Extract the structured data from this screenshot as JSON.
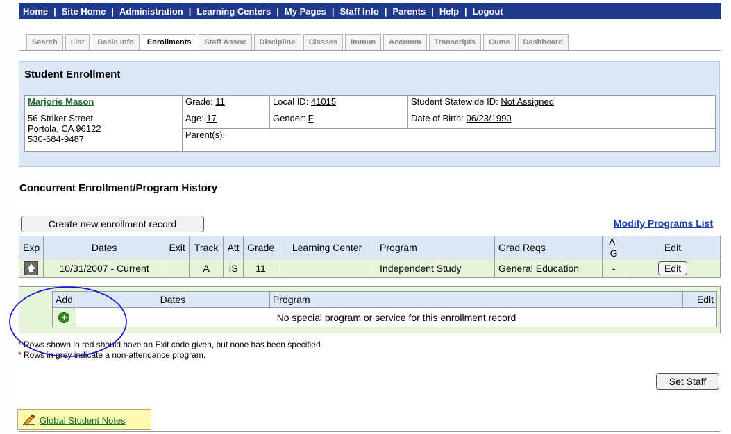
{
  "topnav": {
    "items": [
      "Home",
      "Site Home",
      "Administration",
      "Learning Centers",
      "My Pages",
      "Staff Info",
      "Parents",
      "Help",
      "Logout"
    ],
    "separator": "|"
  },
  "tabs": [
    "Search",
    "List",
    "Basic Info",
    "Enrollments",
    "Staff Assoc",
    "Discipline",
    "Classes",
    "Immun",
    "Accomm",
    "Transcripts",
    "Cume",
    "Dashboard"
  ],
  "active_tab": "Enrollments",
  "student": {
    "section_title": "Student Enrollment",
    "name": "Marjorie Mason",
    "address1": "56 Striker Street",
    "address2": "Portola, CA 96122",
    "phone": "530-684-9487",
    "grade_label": "Grade: ",
    "grade": "11",
    "age_label": "Age: ",
    "age": "17",
    "parents_label": "Parent(s):",
    "local_id_label": "Local ID: ",
    "local_id": "41015",
    "gender_label": "Gender: ",
    "gender": "F",
    "ssid_label": "Student Statewide ID: ",
    "ssid": "Not Assigned",
    "dob_label": "Date of Birth: ",
    "dob": "06/23/1990"
  },
  "history": {
    "title": "Concurrent Enrollment/Program History",
    "create_button": "Create new enrollment record",
    "modify_link": "Modify Programs List",
    "columns": [
      "Exp",
      "Dates",
      "Exit",
      "Track",
      "Att",
      "Grade",
      "Learning Center",
      "Program",
      "Grad Reqs",
      "A-G",
      "Edit"
    ],
    "row": {
      "exp_icon": "arrow-up-icon",
      "dates": "10/31/2007 - Current",
      "exit": "",
      "track": "A",
      "att": "IS",
      "grade": "11",
      "learning_center": "",
      "program": "Independent Study",
      "grad_reqs": "General Education",
      "ag": "-",
      "edit_button": "Edit"
    },
    "sub": {
      "columns": [
        "Add",
        "Dates",
        "Program",
        "Edit"
      ],
      "add_icon": "plus-circle-icon",
      "empty_message": "No special program or service for this enrollment record"
    }
  },
  "notes": {
    "star": "*",
    "red_rows": "Rows shown in red should have an Exit code given, but none has been specified.",
    "grey_rows": "Rows in grey indicate a non-attendance program."
  },
  "set_staff_button": "Set Staff",
  "global_notes": {
    "label": "Global Student Notes",
    "icon": "pencil-icon"
  },
  "colors": {
    "nav_bg": "#1f3a8a",
    "section_bg": "#dce8f5",
    "row_bg": "#e6f5d9",
    "link_green": "#1a6b2b",
    "link_blue": "#1f3fa8",
    "annotation_ellipse": "#1a1ad0"
  }
}
